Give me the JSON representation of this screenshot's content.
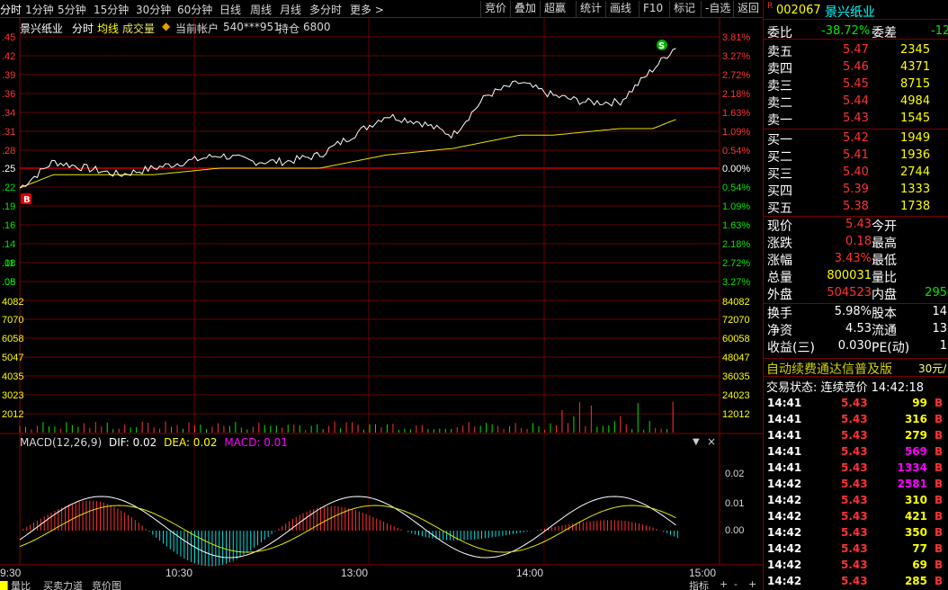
{
  "toolbar": {
    "periods": [
      "分时",
      "1分钟",
      "5分钟",
      "15分钟",
      "30分钟",
      "60分钟",
      "日线",
      "周线",
      "月线",
      "多分时",
      "更多"
    ],
    "buttons": [
      "竞价",
      "叠加",
      "超赢",
      "统计",
      "画线",
      "F10",
      "标记",
      "-自选",
      "返回"
    ]
  },
  "chart_header": {
    "stock_name": "景兴纸业",
    "mode": "分时",
    "avg_line": "均线",
    "volume_label": "成交量",
    "account_label": "当前帐户",
    "account_id": "540***951",
    "position_label": "持仓",
    "position": "6800"
  },
  "macd_header": {
    "label": "MACD(12,26,9)",
    "dif": "DIF: 0.02",
    "dea": "DEA: 0.02",
    "macd": "MACD: 0.01"
  },
  "price_axis": {
    "left": [
      ".45",
      ".42",
      ".39",
      ".36",
      ".34",
      ".31",
      ".28",
      ".25",
      ".22",
      ".19",
      ".16",
      ".14",
      ".11",
      ".08",
      ".05"
    ],
    "right": [
      "3.81%",
      "3.27%",
      "2.72%",
      "2.18%",
      "1.63%",
      "1.09%",
      "0.54%",
      "0.00%",
      "0.54%",
      "1.09%",
      "1.63%",
      "2.18%",
      "2.72%",
      "3.27%"
    ]
  },
  "volume_axis": {
    "left": [
      "4082",
      "7070",
      "6058",
      "5047",
      "4035",
      "3023",
      "2012"
    ],
    "right": [
      "84082",
      "72070",
      "60058",
      "48047",
      "36035",
      "24023",
      "12012"
    ]
  },
  "macd_axis": [
    "0.02",
    "0.01",
    "0.00"
  ],
  "time_axis": [
    "9:30",
    "10:30",
    "13:00",
    "14:00",
    "15:00"
  ],
  "bottom_tabs": [
    "量比",
    "买卖力道",
    "竞价图"
  ],
  "bottom_right": [
    "指标",
    "+",
    "-",
    "+"
  ],
  "chart_data": {
    "type": "line",
    "title": "景兴纸业 分时",
    "x": [
      "09:30",
      "10:30",
      "13:00",
      "14:00",
      "15:00"
    ],
    "prev_close": 5.25,
    "series": [
      {
        "name": "价格",
        "values": [
          5.22,
          5.26,
          5.25,
          5.24,
          5.25,
          5.26,
          5.27,
          5.26,
          5.26,
          5.27,
          5.3,
          5.33,
          5.32,
          5.3,
          5.36,
          5.38,
          5.36,
          5.35,
          5.35,
          5.4,
          5.45,
          5.43
        ]
      },
      {
        "name": "均线",
        "values": [
          5.22,
          5.24,
          5.24,
          5.24,
          5.24,
          5.245,
          5.25,
          5.25,
          5.25,
          5.25,
          5.26,
          5.27,
          5.275,
          5.28,
          5.29,
          5.3,
          5.3,
          5.305,
          5.31,
          5.31,
          5.33,
          5.34
        ]
      }
    ],
    "markers": [
      "B",
      "S"
    ]
  },
  "stock_panel": {
    "code": "002067",
    "name": "景兴纸业",
    "weibi_label": "委比",
    "weibi": "-38.72%",
    "weicha_label": "委差",
    "weicha": "-12",
    "asks": [
      {
        "label": "卖五",
        "price": "5.47",
        "vol": "2345"
      },
      {
        "label": "卖四",
        "price": "5.46",
        "vol": "4371"
      },
      {
        "label": "卖三",
        "price": "5.45",
        "vol": "8715"
      },
      {
        "label": "卖二",
        "price": "5.44",
        "vol": "4984"
      },
      {
        "label": "卖一",
        "price": "5.43",
        "vol": "1545"
      }
    ],
    "bids": [
      {
        "label": "买一",
        "price": "5.42",
        "vol": "1949"
      },
      {
        "label": "买二",
        "price": "5.41",
        "vol": "1936"
      },
      {
        "label": "买三",
        "price": "5.40",
        "vol": "2744"
      },
      {
        "label": "买四",
        "price": "5.39",
        "vol": "1333"
      },
      {
        "label": "买五",
        "price": "5.38",
        "vol": "1738"
      }
    ],
    "stats": [
      {
        "l1": "现价",
        "v1": "5.43",
        "l2": "今开",
        "v2": ""
      },
      {
        "l1": "涨跌",
        "v1": "0.18",
        "l2": "最高",
        "v2": ""
      },
      {
        "l1": "涨幅",
        "v1": "3.43%",
        "l2": "最低",
        "v2": ""
      },
      {
        "l1": "总量",
        "v1": "800031",
        "l2": "量比",
        "v2": ""
      },
      {
        "l1": "外盘",
        "v1": "504523",
        "l2": "内盘",
        "v2": "295"
      },
      {
        "l1": "换手",
        "v1": "5.98%",
        "l2": "股本",
        "v2": "14"
      },
      {
        "l1": "净资",
        "v1": "4.53",
        "l2": "流通",
        "v2": "13"
      },
      {
        "l1": "收益(三)",
        "v1": "0.030",
        "l2": "PE(动)",
        "v2": "1"
      }
    ],
    "promo": "自动续费通达信普及版",
    "promo_price": "30元/",
    "trade_status": "交易状态: 连续竞价 14:42:18",
    "ticks": [
      {
        "t": "14:41",
        "p": "5.43",
        "v": "99",
        "d": "B"
      },
      {
        "t": "14:41",
        "p": "5.43",
        "v": "316",
        "d": "B"
      },
      {
        "t": "14:41",
        "p": "5.43",
        "v": "279",
        "d": "B"
      },
      {
        "t": "14:41",
        "p": "5.43",
        "v": "569",
        "d": "B"
      },
      {
        "t": "14:41",
        "p": "5.43",
        "v": "1334",
        "d": "B"
      },
      {
        "t": "14:42",
        "p": "5.43",
        "v": "2581",
        "d": "B"
      },
      {
        "t": "14:42",
        "p": "5.43",
        "v": "310",
        "d": "B"
      },
      {
        "t": "14:42",
        "p": "5.43",
        "v": "421",
        "d": "B"
      },
      {
        "t": "14:42",
        "p": "5.43",
        "v": "350",
        "d": "B"
      },
      {
        "t": "14:42",
        "p": "5.43",
        "v": "77",
        "d": "B"
      },
      {
        "t": "14:42",
        "p": "5.43",
        "v": "69",
        "d": "B"
      },
      {
        "t": "14:42",
        "p": "5.43",
        "v": "285",
        "d": "B"
      }
    ]
  }
}
